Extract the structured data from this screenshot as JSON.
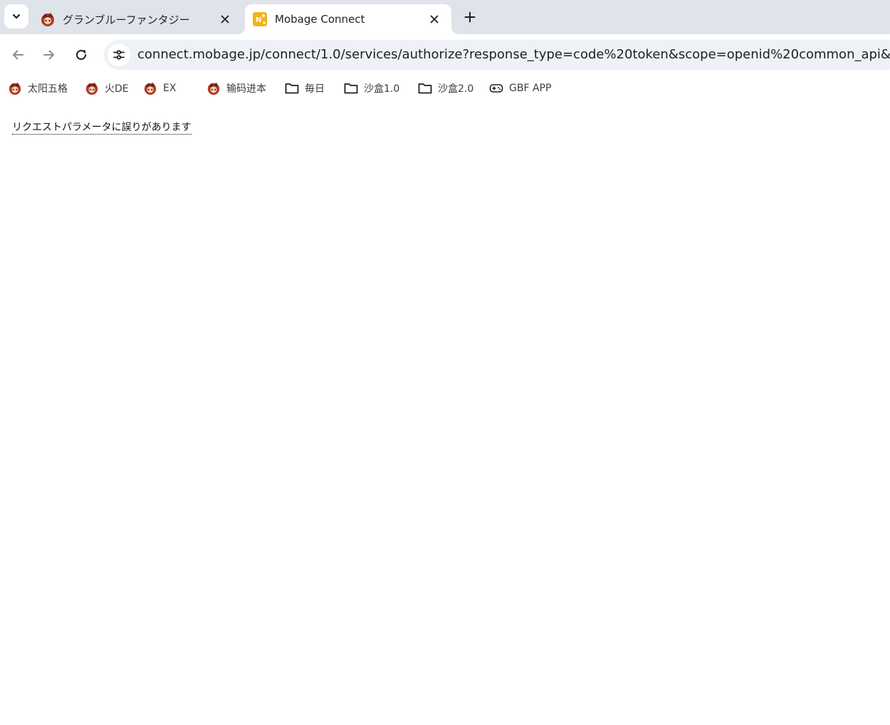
{
  "tabs": [
    {
      "title": "グランブルーファンタジー",
      "favicon": "gbf-character-icon",
      "active": false
    },
    {
      "title": "Mobage Connect",
      "favicon": "mobage-icon",
      "active": true
    }
  ],
  "toolbar": {
    "url": "connect.mobage.jp/connect/1.0/services/authorize?response_type=code%20token&scope=openid%20common_api&redirect_"
  },
  "bookmarks": [
    {
      "label": "太阳五格",
      "icon": "gbf-character-icon"
    },
    {
      "label": "火DE",
      "icon": "gbf-character-icon"
    },
    {
      "label": "EX",
      "icon": "gbf-character-icon"
    },
    {
      "label": "输码进本",
      "icon": "gbf-character-icon"
    },
    {
      "label": "毎日",
      "icon": "folder-icon"
    },
    {
      "label": "沙盒1.0",
      "icon": "folder-icon"
    },
    {
      "label": "沙盒2.0",
      "icon": "folder-icon"
    },
    {
      "label": "GBF APP",
      "icon": "gamepad-icon"
    }
  ],
  "page": {
    "error_message": "リクエストパラメータに誤りがあります"
  },
  "colors": {
    "tabstrip_bg": "#dfe3ea",
    "omnibox_bg": "#eef1f6",
    "mobage_favicon": "#f2b418"
  }
}
